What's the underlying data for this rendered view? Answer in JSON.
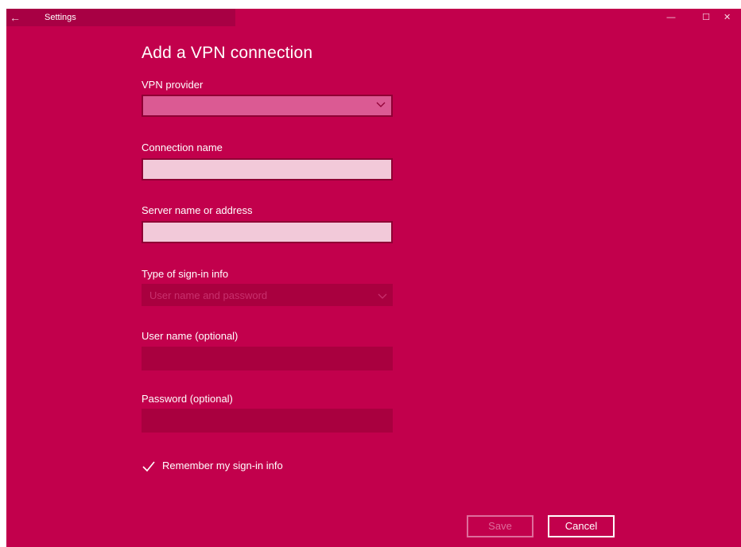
{
  "window": {
    "title": "Settings",
    "back_glyph": "←",
    "minimize_glyph": "—",
    "maximize_glyph": "☐",
    "close_glyph": "✕"
  },
  "dialog": {
    "heading": "Add a VPN connection",
    "vpn_provider": {
      "label": "VPN provider",
      "value": ""
    },
    "connection_name": {
      "label": "Connection name",
      "value": ""
    },
    "server": {
      "label": "Server name or address",
      "value": ""
    },
    "signin_type": {
      "label": "Type of sign-in info",
      "value": "User name and password"
    },
    "username": {
      "label": "User name (optional)",
      "value": ""
    },
    "password": {
      "label": "Password (optional)",
      "value": ""
    },
    "remember": {
      "label": "Remember my sign-in info",
      "checked": true
    },
    "buttons": {
      "save": "Save",
      "cancel": "Cancel"
    }
  },
  "colors": {
    "accent": "#c2004c",
    "titlebar_dark": "#a80044",
    "disabled_field": "#a9003f",
    "input_fill": "#f2c9d9",
    "select_fill": "#db5a93"
  }
}
